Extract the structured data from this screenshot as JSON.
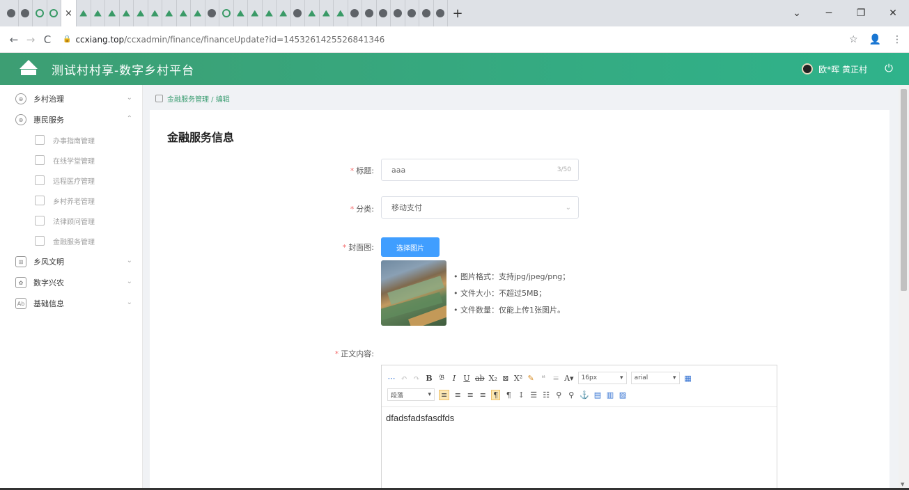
{
  "browser": {
    "url_host": "ccxiang.top",
    "url_path": "/ccxadmin/finance/financeUpdate?id=1453261425526841346",
    "active_tab_close": "×",
    "new_tab": "+",
    "win_min": "─",
    "win_max": "❐",
    "win_close": "✕",
    "tab_dropdown": "⌄"
  },
  "app": {
    "title": "测试村村享-数字乡村平台",
    "user_name": "欧*晖 黄正村"
  },
  "sidebar": {
    "items": [
      {
        "label": "乡村治理",
        "icon": "governance-icon"
      },
      {
        "label": "惠民服务",
        "icon": "service-icon"
      }
    ],
    "sub_items": [
      {
        "label": "办事指南管理"
      },
      {
        "label": "在线学堂管理"
      },
      {
        "label": "远程医疗管理"
      },
      {
        "label": "乡村养老管理"
      },
      {
        "label": "法律顾问管理"
      },
      {
        "label": "金融服务管理"
      }
    ],
    "bottom_items": [
      {
        "label": "乡风文明"
      },
      {
        "label": "数字兴农"
      },
      {
        "label": "基础信息"
      }
    ]
  },
  "breadcrumb": "金融服务管理 / 编辑",
  "form": {
    "section_title": "金融服务信息",
    "title_label": "标题:",
    "title_value": "aaa",
    "title_count": "3/50",
    "category_label": "分类:",
    "category_value": "移动支付",
    "cover_label": "封面图:",
    "choose_image_btn": "选择图片",
    "hint_format": "• 图片格式：支持jpg/jpeg/png；",
    "hint_size": "• 文件大小：不超过5MB；",
    "hint_count": "• 文件数量：仅能上传1张图片。",
    "content_label": "正文内容:",
    "editor_text": "dfadsfadsfasdfds",
    "font_size": "16px",
    "font_family": "arial",
    "paragraph": "段落"
  }
}
